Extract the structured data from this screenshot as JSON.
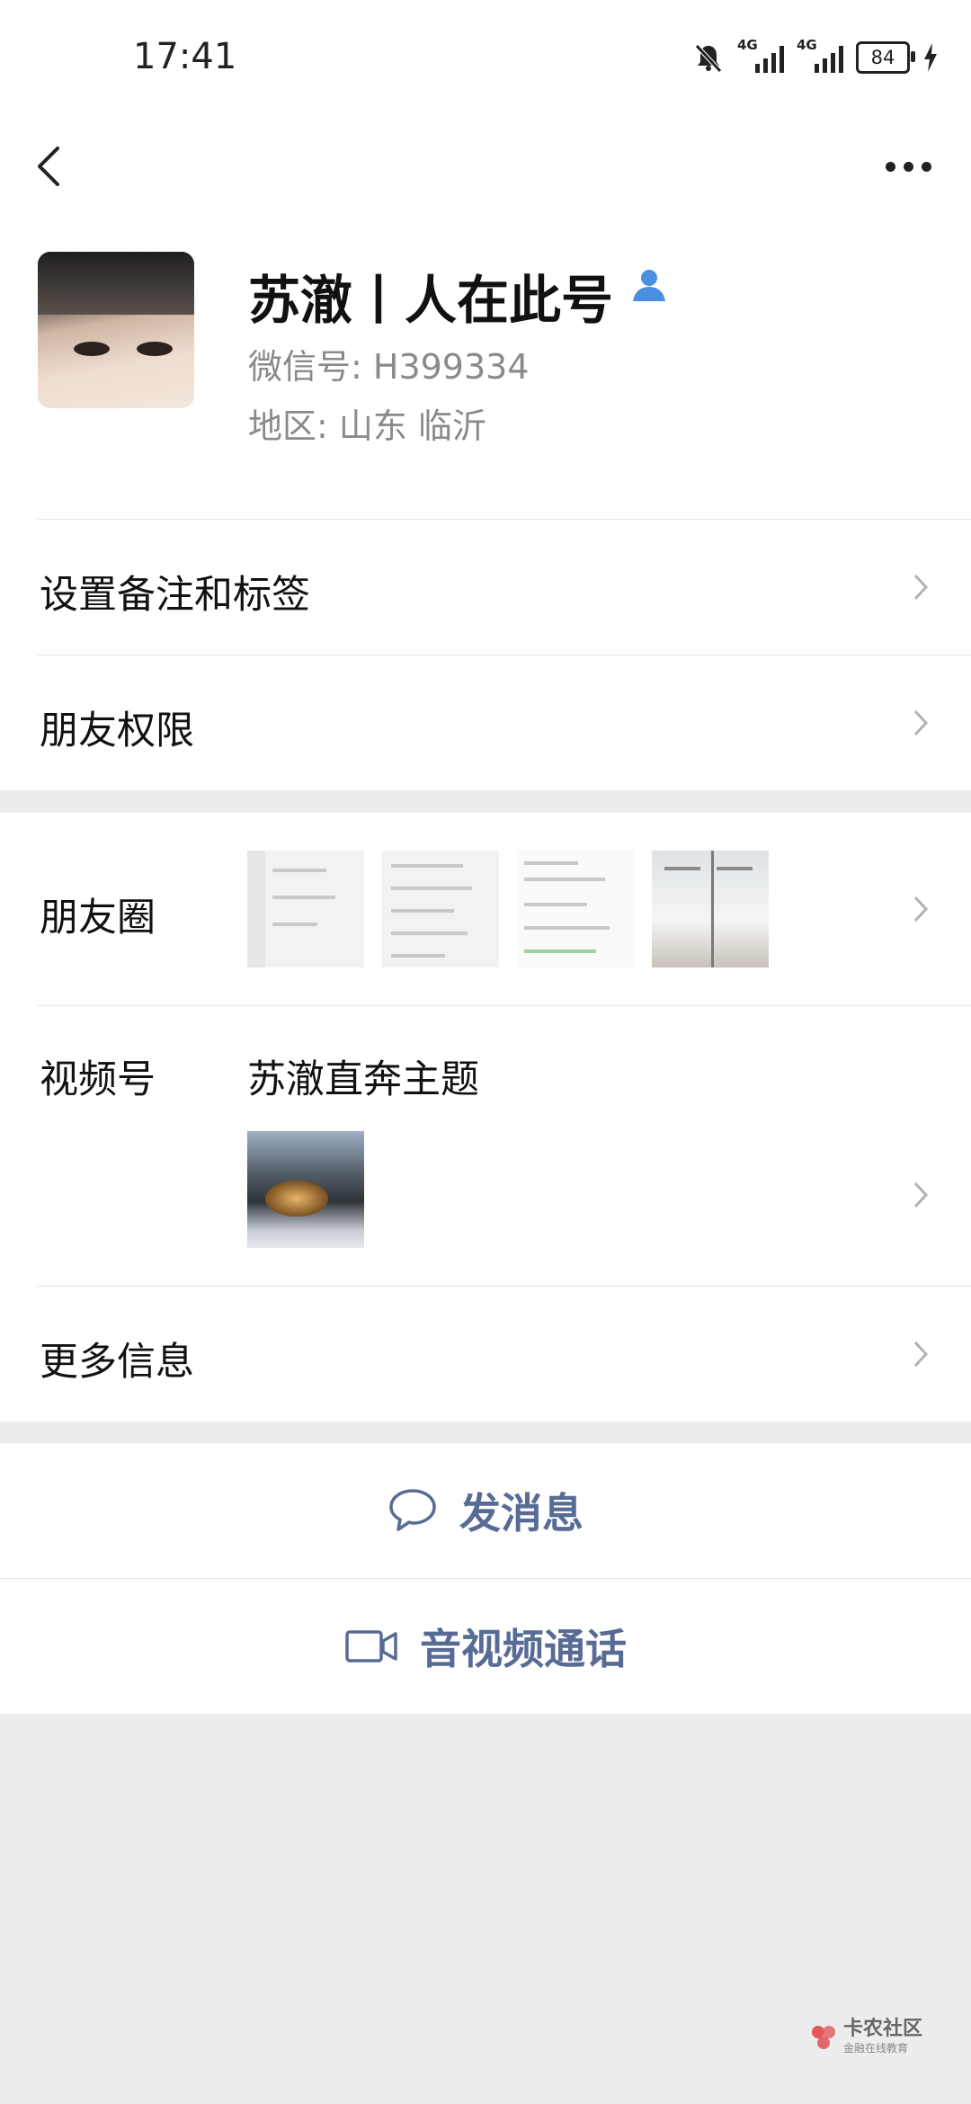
{
  "status_bar": {
    "time": "17:41",
    "battery": "84",
    "signal_label_1": "4G",
    "signal_label_2": "4G"
  },
  "profile": {
    "nickname": "苏澈丨人在此号",
    "wechat_id": "微信号: H399334",
    "region": "地区: 山东  临沂"
  },
  "rows": {
    "remark": "设置备注和标签",
    "permissions": "朋友权限",
    "moments": "朋友圈",
    "channels": "视频号",
    "channel_name": "苏澈直奔主题",
    "more_info": "更多信息"
  },
  "actions": {
    "message": "发消息",
    "call": "音视频通话"
  },
  "watermark": {
    "title": "卡农社区",
    "subtitle": "金融在线教育"
  },
  "colors": {
    "link": "#576b95",
    "verify": "#4a90e2"
  }
}
